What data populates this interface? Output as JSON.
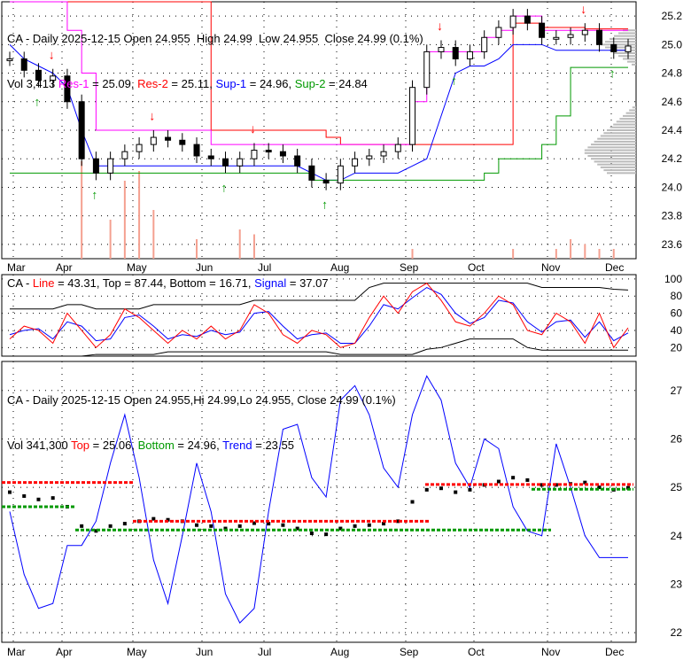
{
  "colors": {
    "res1": "#ff00ff",
    "res2": "#ff0000",
    "sup1": "#0000ff",
    "sup2": "#009900",
    "volume": "#f4a090",
    "line": "#ff0000",
    "signal": "#0000ff",
    "trend": "#0000ff",
    "up": "#009900",
    "down": "#ff0000"
  },
  "panel1": {
    "title": "CA - Daily 2025-12-15 Open 24.955  High 24.99  Low 24.955  Close 24.99 (0.1%)",
    "vol": "Vol 3,413",
    "res1_label": "Res-1",
    "res1_value": " = 25.09,",
    "res2_label": "Res-2",
    "res2_value": " = 25.11,",
    "sup1_label": "Sup-1",
    "sup1_value": " = 24.96,",
    "sup2_label": "Sup-2",
    "sup2_value": " = 24.84"
  },
  "panel2": {
    "prefix": "CA - ",
    "line_label": "Line",
    "line_value": " = 43.31, Top = 87.44, Bottom = 16.71, ",
    "signal_label": "Signal",
    "signal_value": " = 37.07"
  },
  "panel3": {
    "title": "CA - Daily 2025-12-15 Open 24.955,Hi 24.99,Lo 24.955, Close 24.99 (0.1%)",
    "vol": "Vol 341,300 ",
    "top_label": "Top",
    "top_value": " = 25.06, ",
    "bottom_label": "Bottom",
    "bottom_value": " = 24.96, ",
    "trend_label": "Trend",
    "trend_value": " = 23.55"
  },
  "chart_data": [
    {
      "type": "candlestick",
      "title": "CA - Daily",
      "months": [
        "Mar",
        "Apr",
        "May",
        "Jun",
        "Jul",
        "Aug",
        "Sep",
        "Oct",
        "Nov",
        "Dec"
      ],
      "y_ticks": [
        23.6,
        23.8,
        24.0,
        24.2,
        24.4,
        24.6,
        24.8,
        25.0,
        25.2
      ],
      "ylim": [
        23.5,
        25.3
      ],
      "weekly_close": [
        24.9,
        24.82,
        24.75,
        24.78,
        24.6,
        24.2,
        24.1,
        24.2,
        24.25,
        24.3,
        24.35,
        24.33,
        24.3,
        24.22,
        24.2,
        24.15,
        24.2,
        24.26,
        24.25,
        24.22,
        24.15,
        24.05,
        24.03,
        24.15,
        24.2,
        24.22,
        24.25,
        24.3,
        24.7,
        24.95,
        24.98,
        24.9,
        24.95,
        25.05,
        25.12,
        25.2,
        25.15,
        25.05,
        25.05,
        25.07,
        25.1,
        25.0,
        24.95,
        24.99
      ],
      "volume_spikes": [
        0,
        0,
        0,
        0,
        0,
        1,
        0,
        0.4,
        0.8,
        0.9,
        0.5,
        0,
        0,
        0.2,
        0,
        0,
        0.3,
        0.25,
        0,
        0,
        0,
        0,
        0,
        0,
        0,
        0,
        0,
        0,
        0.1,
        0,
        0,
        0,
        0,
        0,
        0,
        0.1,
        0,
        0,
        0.1,
        0.2,
        0.15,
        0.1,
        0.1,
        0
      ],
      "res1": [
        25.3,
        25.3,
        25.3,
        25.3,
        25.1,
        24.8,
        24.4,
        24.4,
        24.4,
        24.4,
        24.4,
        24.4,
        24.4,
        24.4,
        24.3,
        24.3,
        24.3,
        24.3,
        24.3,
        24.3,
        24.3,
        24.3,
        24.3,
        24.3,
        24.3,
        24.3,
        24.3,
        24.3,
        24.6,
        24.95,
        24.95,
        24.95,
        24.95,
        25.05,
        25.1,
        25.2,
        25.2,
        25.1,
        25.1,
        25.1,
        25.1,
        25.1,
        25.1,
        25.1
      ],
      "res2": [
        25.3,
        25.3,
        25.3,
        25.3,
        25.3,
        25.3,
        25.3,
        25.3,
        25.3,
        25.3,
        25.3,
        25.3,
        25.3,
        25.3,
        24.4,
        24.4,
        24.4,
        24.4,
        24.4,
        24.4,
        24.4,
        24.4,
        24.35,
        24.3,
        24.3,
        24.3,
        24.3,
        24.3,
        24.3,
        24.3,
        24.3,
        24.3,
        24.3,
        24.3,
        24.3,
        25.15,
        25.15,
        25.12,
        25.12,
        25.12,
        25.11,
        25.11,
        25.11,
        25.11
      ],
      "sup1": [
        25.0,
        24.9,
        24.85,
        24.8,
        24.7,
        24.4,
        24.15,
        24.15,
        24.15,
        24.15,
        24.15,
        24.15,
        24.15,
        24.15,
        24.15,
        24.15,
        24.15,
        24.15,
        24.15,
        24.15,
        24.15,
        24.1,
        24.05,
        24.05,
        24.1,
        24.1,
        24.1,
        24.1,
        24.15,
        24.2,
        24.5,
        24.8,
        24.85,
        24.85,
        24.9,
        25.0,
        25.0,
        25.0,
        24.96,
        24.96,
        24.96,
        24.96,
        24.96,
        24.96
      ],
      "sup2": [
        24.1,
        24.1,
        24.1,
        24.1,
        24.1,
        24.1,
        24.1,
        24.1,
        24.1,
        24.1,
        24.1,
        24.1,
        24.1,
        24.1,
        24.1,
        24.1,
        24.1,
        24.1,
        24.1,
        24.1,
        24.1,
        24.05,
        24.05,
        24.05,
        24.05,
        24.05,
        24.05,
        24.05,
        24.05,
        24.05,
        24.05,
        24.05,
        24.05,
        24.1,
        24.2,
        24.2,
        24.2,
        24.3,
        24.5,
        24.84,
        24.84,
        24.84,
        24.84,
        24.84
      ]
    },
    {
      "type": "line",
      "title": "CA - Stochastic",
      "y_ticks": [
        20,
        40,
        60,
        80,
        100
      ],
      "ylim": [
        10,
        105
      ],
      "line": [
        30,
        45,
        40,
        25,
        60,
        40,
        20,
        35,
        65,
        55,
        40,
        25,
        40,
        30,
        45,
        30,
        40,
        70,
        60,
        35,
        25,
        40,
        35,
        20,
        25,
        55,
        80,
        60,
        85,
        95,
        75,
        50,
        45,
        60,
        80,
        70,
        40,
        35,
        60,
        50,
        25,
        60,
        20,
        43
      ],
      "signal": [
        35,
        40,
        42,
        30,
        50,
        45,
        28,
        30,
        55,
        58,
        45,
        30,
        35,
        33,
        40,
        35,
        38,
        60,
        62,
        45,
        30,
        35,
        37,
        25,
        25,
        45,
        70,
        65,
        78,
        90,
        82,
        60,
        48,
        55,
        75,
        72,
        50,
        38,
        50,
        52,
        32,
        50,
        28,
        37
      ],
      "top": [
        65,
        65,
        65,
        65,
        70,
        70,
        65,
        65,
        65,
        65,
        70,
        70,
        70,
        70,
        70,
        70,
        70,
        75,
        75,
        75,
        75,
        75,
        75,
        75,
        75,
        90,
        95,
        95,
        95,
        95,
        95,
        95,
        95,
        95,
        95,
        95,
        95,
        90,
        90,
        90,
        90,
        90,
        88,
        87
      ],
      "bottom": [
        10,
        10,
        10,
        10,
        10,
        10,
        12,
        12,
        12,
        12,
        12,
        15,
        15,
        15,
        15,
        15,
        15,
        15,
        15,
        15,
        15,
        15,
        15,
        12,
        12,
        12,
        12,
        12,
        12,
        18,
        20,
        25,
        30,
        30,
        30,
        30,
        20,
        17,
        17,
        17,
        17,
        17,
        17,
        17
      ]
    },
    {
      "type": "line",
      "title": "CA - Daily trend",
      "y_ticks": [
        22,
        23,
        24,
        25,
        26,
        27
      ],
      "ylim": [
        21.8,
        27.6
      ],
      "close": [
        24.9,
        24.82,
        24.75,
        24.78,
        24.6,
        24.2,
        24.1,
        24.2,
        24.25,
        24.3,
        24.35,
        24.33,
        24.3,
        24.22,
        24.2,
        24.15,
        24.2,
        24.26,
        24.25,
        24.22,
        24.15,
        24.05,
        24.03,
        24.15,
        24.2,
        24.22,
        24.25,
        24.3,
        24.7,
        24.95,
        24.98,
        24.9,
        24.95,
        25.05,
        25.12,
        25.2,
        25.15,
        25.05,
        25.05,
        25.07,
        25.1,
        25.0,
        24.95,
        24.99
      ],
      "trend": [
        24.5,
        23.2,
        22.5,
        22.6,
        23.8,
        23.8,
        24.3,
        25.5,
        26.5,
        25.2,
        23.5,
        22.6,
        24.0,
        25.5,
        24.5,
        22.8,
        22.2,
        22.5,
        24.5,
        26.2,
        26.3,
        25.2,
        24.8,
        26.8,
        27.1,
        26.5,
        25.4,
        25.0,
        26.5,
        27.3,
        26.8,
        25.5,
        25.0,
        26.0,
        25.8,
        24.6,
        24.1,
        24.0,
        25.9,
        25.0,
        24.0,
        23.55,
        23.55,
        23.55
      ]
    }
  ]
}
